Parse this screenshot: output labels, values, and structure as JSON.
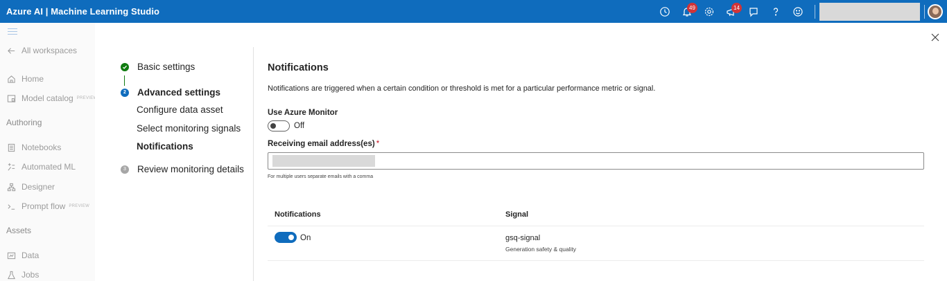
{
  "topbar": {
    "title": "Azure AI | Machine Learning Studio",
    "notifications_badge": "49",
    "feedback_badge": "14",
    "icons": [
      "clock-icon",
      "bell-icon",
      "gear-icon",
      "megaphone-icon",
      "chat-icon",
      "help-icon",
      "smiley-icon"
    ]
  },
  "sidebar": {
    "back_label": "All workspaces",
    "home_label": "Home",
    "model_catalog_label": "Model catalog",
    "preview_tag": "PREVIEW",
    "authoring_header": "Authoring",
    "notebooks_label": "Notebooks",
    "automl_label": "Automated ML",
    "designer_label": "Designer",
    "promptflow_label": "Prompt flow",
    "assets_header": "Assets",
    "data_label": "Data",
    "jobs_label": "Jobs"
  },
  "stepper": {
    "step1": "Basic settings",
    "step2": "Advanced settings",
    "step2_number": "2",
    "sub1": "Configure data asset",
    "sub2": "Select monitoring signals",
    "sub3": "Notifications",
    "step3": "Review monitoring details",
    "step3_number": "3"
  },
  "form": {
    "title": "Notifications",
    "description": "Notifications are triggered when a certain condition or threshold is met for a particular performance metric or signal.",
    "azure_monitor_label": "Use Azure Monitor",
    "azure_monitor_state": "Off",
    "email_label": "Receiving email address(es)",
    "required_mark": "*",
    "email_hint": "For multiple users separate emails with a comma"
  },
  "table": {
    "col_notifications": "Notifications",
    "col_signal": "Signal",
    "rows": [
      {
        "toggle_state": "On",
        "signal_name": "gsq-signal",
        "signal_type": "Generation safety & quality"
      }
    ]
  },
  "colors": {
    "brand": "#0f6cbd",
    "success": "#107c10",
    "badge": "#d13438"
  }
}
